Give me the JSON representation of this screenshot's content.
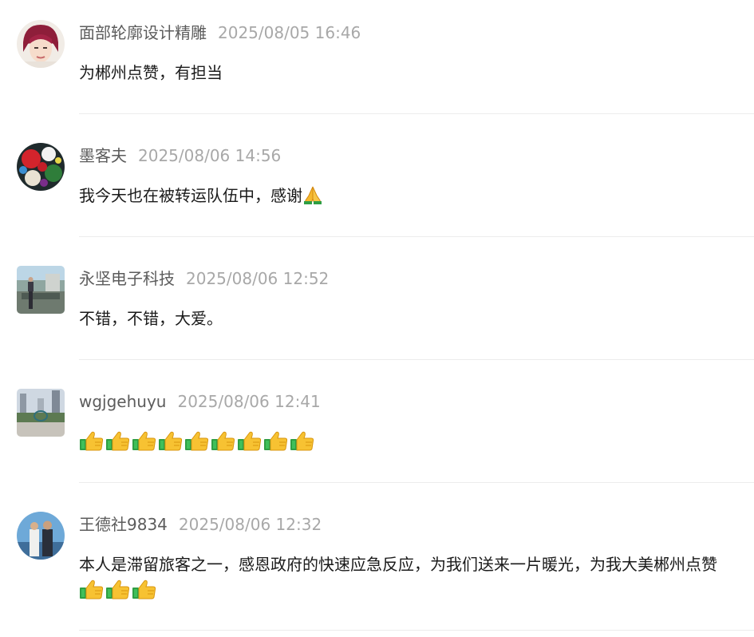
{
  "colors": {
    "name": "#5c5c5c",
    "time": "#a8a8a8",
    "text": "#1a1a1a",
    "divider": "#ececec"
  },
  "comments": [
    {
      "author": "面部轮廓设计精雕",
      "time": "2025/08/05 16:46",
      "text": "为郴州点赞，有担当",
      "emoji": []
    },
    {
      "author": "墨客夫",
      "time": "2025/08/06 14:56",
      "text": "我今天也在被转运队伍中，感谢",
      "emoji": [
        "folded-hands"
      ]
    },
    {
      "author": "永坚电子科技",
      "time": "2025/08/06 12:52",
      "text": "不错，不错，大爱。",
      "emoji": []
    },
    {
      "author": "wgjgehuyu",
      "time": "2025/08/06 12:41",
      "text": "",
      "emoji": [
        "thumbs-up",
        "thumbs-up",
        "thumbs-up",
        "thumbs-up",
        "thumbs-up",
        "thumbs-up",
        "thumbs-up",
        "thumbs-up",
        "thumbs-up"
      ]
    },
    {
      "author": "王德社9834",
      "time": "2025/08/06 12:32",
      "text": "本人是滞留旅客之一，感恩政府的快速应急反应，为我们送来一片暖光，为我大美郴州点赞",
      "emoji": [
        "thumbs-up",
        "thumbs-up",
        "thumbs-up"
      ]
    }
  ]
}
